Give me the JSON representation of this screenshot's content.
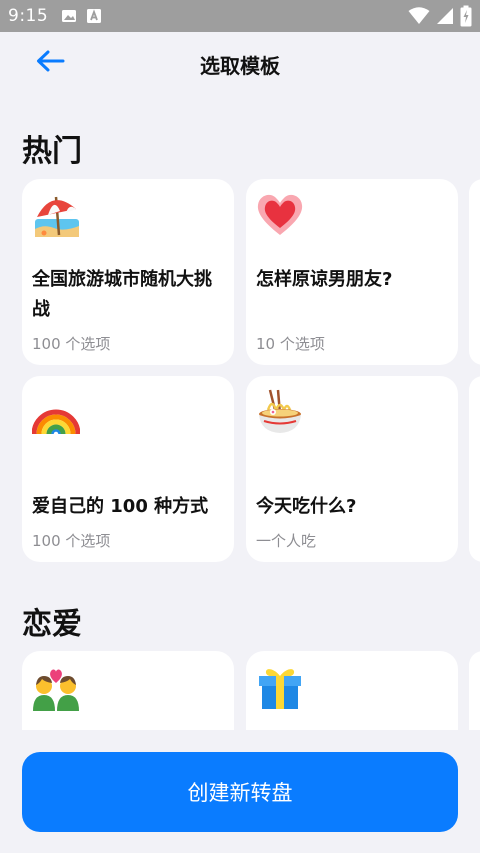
{
  "status_bar": {
    "time": "9:15",
    "left_icons": [
      "image-icon",
      "a-letter-icon"
    ],
    "right_icons": [
      "wifi-icon",
      "signal-icon",
      "battery-charging-icon"
    ]
  },
  "header": {
    "title": "选取模板",
    "back_icon": "arrow-left-icon"
  },
  "sections": [
    {
      "title": "热门",
      "cards": [
        {
          "icon": "beach-umbrella-icon",
          "title": "全国旅游城市随机大挑战",
          "subtitle": "100 个选项"
        },
        {
          "icon": "glowing-heart-icon",
          "title": "怎样原谅男朋友?",
          "subtitle": "10 个选项"
        },
        {
          "icon": "rainbow-icon",
          "title": "爱自己的 100 种方式",
          "subtitle": "100 个选项"
        },
        {
          "icon": "noodle-bowl-icon",
          "title": "今天吃什么?",
          "subtitle": "一个人吃"
        }
      ]
    },
    {
      "title": "恋爱",
      "cards": [
        {
          "icon": "couple-heart-icon"
        },
        {
          "icon": "gift-icon"
        }
      ]
    }
  ],
  "create_button": {
    "label": "创建新转盘"
  },
  "colors": {
    "accent": "#0a7cff",
    "background": "#f2f2f7",
    "card": "#ffffff",
    "status_bar": "#9e9e9e",
    "subtitle": "#8e8e93"
  }
}
